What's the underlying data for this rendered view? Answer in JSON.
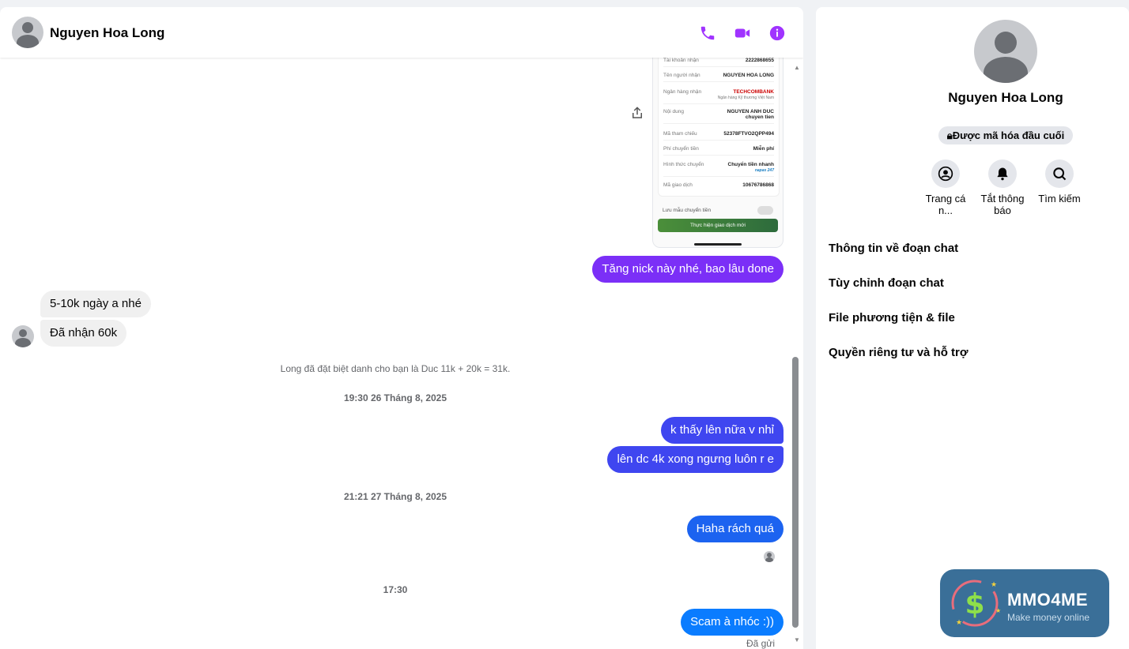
{
  "header": {
    "contact_name": "Nguyen Hoa Long"
  },
  "attachment": {
    "rows": [
      {
        "label": "Tài khoản nhận",
        "value": "2222868655"
      },
      {
        "label": "Tên người nhận",
        "value": "NGUYEN HOA LONG"
      },
      {
        "label": "Ngân hàng nhận",
        "value": "TECHCOMBANK",
        "sub": "Ngân hàng Kỹ thương Việt Nam"
      },
      {
        "label": "Nội dung",
        "value": "NGUYEN ANH DUC",
        "sub": "chuyen tien"
      },
      {
        "label": "Mã tham chiếu",
        "value": "52378FTVO2QPP494"
      },
      {
        "label": "Phí chuyển tiền",
        "value": "Miễn phí"
      },
      {
        "label": "Hình thức chuyển",
        "value": "Chuyển tiền nhanh",
        "sub": "napas 247"
      },
      {
        "label": "Mã giao dịch",
        "value": "10676786868"
      }
    ],
    "toggle_label": "Lưu mẫu chuyển tiền",
    "button_label": "Thực hiện giao dịch mới"
  },
  "messages": {
    "m1": "Tăng nick này nhé, bao lâu done",
    "m2": "5-10k ngày a nhé",
    "m3": "Đã nhận 60k",
    "system_note": "Long đã đặt biệt danh cho bạn là Duc 11k + 20k = 31k.",
    "ts1": "19:30 26 Tháng 8, 2025",
    "m4": "k thấy lên nữa v nhỉ",
    "m5": "lên dc 4k xong ngưng luôn r e",
    "ts2": "21:21 27 Tháng 8, 2025",
    "m6": "Haha rách quá",
    "ts3": "17:30",
    "m7": "Scam à nhóc :))",
    "sent_status": "Đã gửi"
  },
  "info": {
    "name": "Nguyen Hoa Long",
    "e2e": "Được mã hóa đầu cuối",
    "actions": {
      "profile": "Trang cá n...",
      "mute": "Tắt thông báo",
      "search": "Tìm kiếm"
    },
    "sections": {
      "chat_info": "Thông tin về đoạn chat",
      "customize": "Tùy chỉnh đoạn chat",
      "media": "File phương tiện & file",
      "privacy": "Quyền riêng tư và hỗ trợ"
    }
  },
  "watermark": {
    "title": "MMO4ME",
    "tagline": "Make money online"
  },
  "colors": {
    "accent_purple": "#a033ff",
    "bubble_purple": "#7b2ff7",
    "bubble_indigo": "#3f46f0",
    "bubble_blue": "#1c63f0",
    "bubble_light_blue": "#0a7cff"
  }
}
